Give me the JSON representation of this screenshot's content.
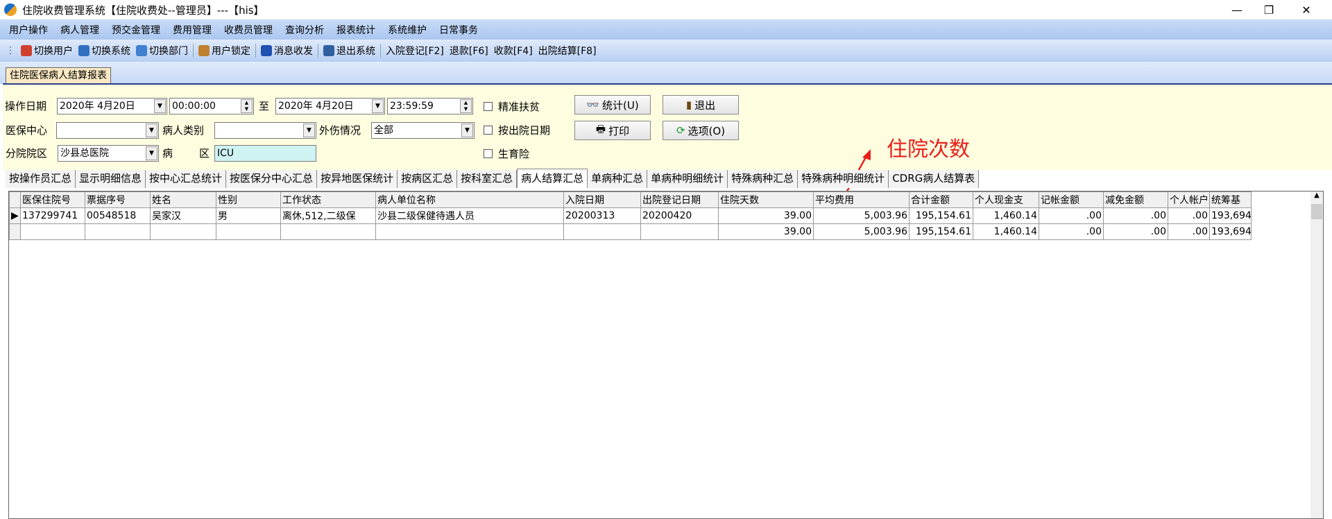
{
  "window": {
    "title": "住院收费管理系统【住院收费处--管理员】---【his】"
  },
  "menu": [
    "用户操作",
    "病人管理",
    "预交金管理",
    "费用管理",
    "收费员管理",
    "查询分析",
    "报表统计",
    "系统维护",
    "日常事务"
  ],
  "toolbar": [
    {
      "label": "切换用户",
      "icon": "users-icon",
      "color": "#d04030"
    },
    {
      "label": "切换系统",
      "icon": "switch-system-icon",
      "color": "#3070c0"
    },
    {
      "label": "切换部门",
      "icon": "department-icon",
      "color": "#4080d0"
    },
    {
      "label": "用户锁定",
      "icon": "user-lock-icon",
      "color": "#c08030"
    },
    {
      "label": "消息收发",
      "icon": "info-icon",
      "color": "#2050b0"
    },
    {
      "label": "退出系统",
      "icon": "exit-icon",
      "color": "#3060a0"
    }
  ],
  "toolbar_text": [
    "入院登记[F2]",
    "退款[F6]",
    "收款[F4]",
    "出院结算[F8]"
  ],
  "form_tab": "住院医保病人结算报表",
  "filters": {
    "op_date_label": "操作日期",
    "date_from": "2020年 4月20日",
    "time_from": "00:00:00",
    "to_label": "至",
    "date_to": "2020年 4月20日",
    "time_to": "23:59:59",
    "center_label": "医保中心",
    "center_value": "",
    "patient_type_label": "病人类别",
    "patient_type_value": "",
    "injury_label": "外伤情况",
    "injury_value": "全部",
    "branch_label": "分院院区",
    "branch_value": "沙县总医院",
    "ward_label1": "病",
    "ward_label2": "区",
    "ward_value": "ICU",
    "checkboxes": [
      "精准扶贫",
      "按出院日期",
      "生育险"
    ]
  },
  "buttons": {
    "stat": "统计(U)",
    "exit": "退出",
    "print": "打印",
    "options": "选项(O)"
  },
  "annotation": "住院次数",
  "tabs": [
    "按操作员汇总",
    "显示明细信息",
    "按中心汇总统计",
    "按医保分中心汇总",
    "按异地医保统计",
    "按病区汇总",
    "按科室汇总",
    "病人结算汇总",
    "单病种汇总",
    "单病种明细统计",
    "特殊病种汇总",
    "特殊病种明细统计",
    "CDRG病人结算表"
  ],
  "active_tab": "病人结算汇总",
  "grid": {
    "columns": [
      "医保住院号",
      "票据序号",
      "姓名",
      "性别",
      "工作状态",
      "病人单位名称",
      "入院日期",
      "出院登记日期",
      "住院天数",
      "平均费用",
      "合计金额",
      "个人现金支",
      "记帐金额",
      "减免金额",
      "个人帐户支",
      "统筹基"
    ],
    "rows": [
      [
        "137299741",
        "00548518",
        "吴家汉",
        "男",
        "离休,512,二级保",
        "沙县二级保健待遇人员",
        "20200313",
        "20200420",
        "39.00",
        "5,003.96",
        "195,154.61",
        "1,460.14",
        ".00",
        ".00",
        ".00",
        "193,694"
      ],
      [
        "",
        "",
        "",
        "",
        "",
        "",
        "",
        "",
        "39.00",
        "5,003.96",
        "195,154.61",
        "1,460.14",
        ".00",
        ".00",
        ".00",
        "193,694"
      ]
    ]
  },
  "colors": {
    "annotation": "#e8201c",
    "panel": "#fffde0",
    "menubar": "#b8cff2"
  }
}
